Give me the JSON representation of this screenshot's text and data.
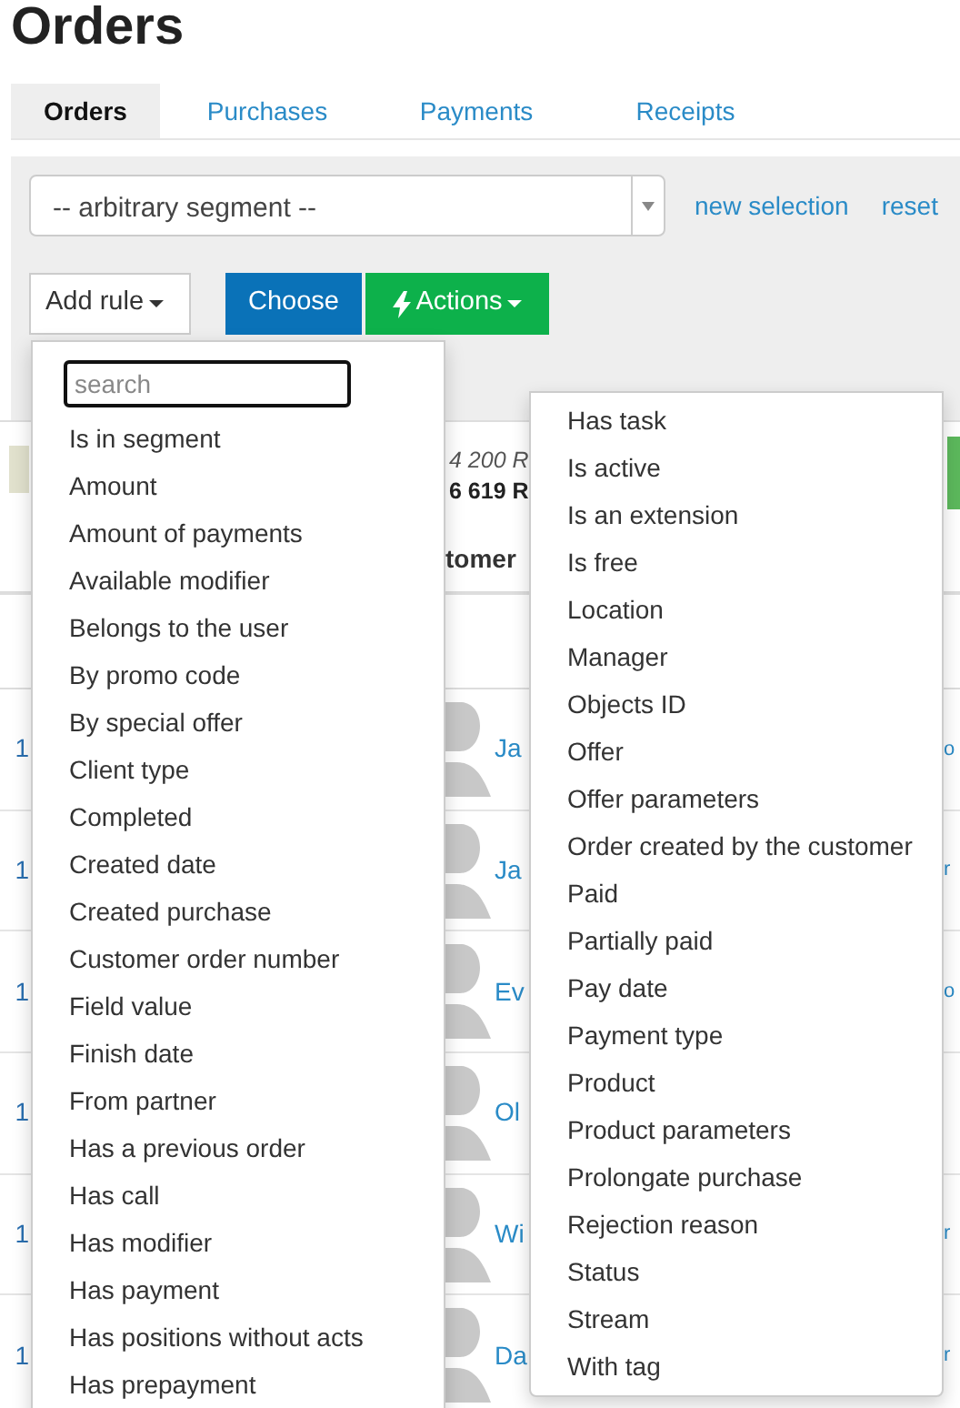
{
  "title": "Orders",
  "tabs": [
    {
      "label": "Orders",
      "selected": true
    },
    {
      "label": "Purchases",
      "selected": false
    },
    {
      "label": "Payments",
      "selected": false
    },
    {
      "label": "Receipts",
      "selected": false
    }
  ],
  "segment_select": {
    "value": "-- arbitrary segment --"
  },
  "links": [
    "new selection",
    "reset"
  ],
  "buttons": {
    "add_rule": "Add rule",
    "choose": "Choose",
    "actions": "Actions"
  },
  "totals": {
    "line_1": "4 200 R",
    "line_2": "6 619 R"
  },
  "table": {
    "column_header": "tomer",
    "rows": [
      {
        "number": "1",
        "customer": "Ja",
        "column_3": "o"
      },
      {
        "number": "1",
        "customer": "Ja",
        "column_3": "r"
      },
      {
        "number": "1",
        "customer": "Ev",
        "column_3": "o"
      },
      {
        "number": "1",
        "customer": "Ol"
      },
      {
        "number": "1",
        "customer": "Wi",
        "column_3": "r"
      },
      {
        "number": "1",
        "customer": "Da",
        "column_3": "r"
      }
    ]
  },
  "rule_menu": {
    "search_placeholder": "search",
    "items": [
      "Is in segment",
      "Amount",
      "Amount of payments",
      "Available modifier",
      "Belongs to the user",
      "By promo code",
      "By special offer",
      "Client type",
      "Completed",
      "Created date",
      "Created purchase",
      "Customer order number",
      "Field value",
      "Finish date",
      "From partner",
      "Has a previous order",
      "Has call",
      "Has modifier",
      "Has payment",
      "Has positions without acts",
      "Has prepayment"
    ]
  },
  "rule_menu_continued": {
    "items": [
      "Has task",
      "Is active",
      "Is an extension",
      "Is free",
      "Location",
      "Manager",
      "Objects ID",
      "Offer",
      "Offer parameters",
      "Order created by the customer",
      "Paid",
      "Partially paid",
      "Pay date",
      "Payment type",
      "Product",
      "Product parameters",
      "Prolongate purchase",
      "Rejection reason",
      "Status",
      "Stream",
      "With tag"
    ]
  }
}
